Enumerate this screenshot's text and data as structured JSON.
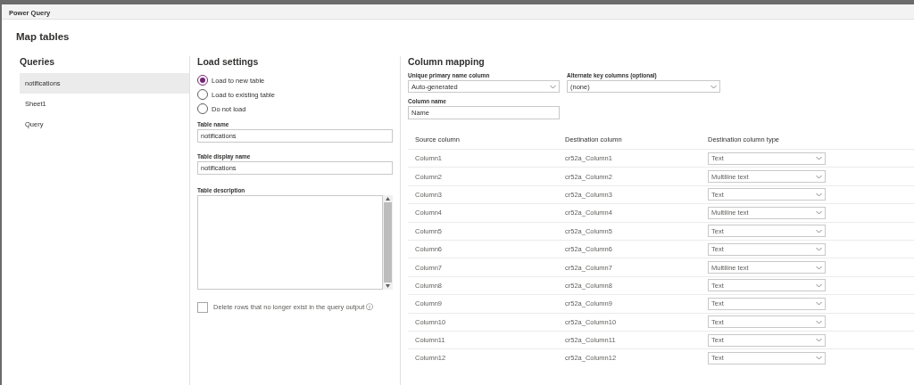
{
  "window": {
    "title": "Power Query"
  },
  "page_title": "Map tables",
  "queries": {
    "heading": "Queries",
    "items": [
      {
        "label": "notifications",
        "selected": true
      },
      {
        "label": "Sheet1",
        "selected": false
      },
      {
        "label": "Query",
        "selected": false
      }
    ]
  },
  "load_settings": {
    "heading": "Load settings",
    "options": [
      {
        "label": "Load to new table",
        "selected": true
      },
      {
        "label": "Load to existing table",
        "selected": false
      },
      {
        "label": "Do not load",
        "selected": false
      }
    ],
    "table_name": {
      "label": "Table name",
      "value": "notifications"
    },
    "table_display_name": {
      "label": "Table display name",
      "value": "notifications"
    },
    "table_description": {
      "label": "Table description"
    },
    "delete_rows": {
      "label": "Delete rows that no longer exist in the query output",
      "info": "ⓘ",
      "checked": false
    }
  },
  "column_mapping": {
    "heading": "Column mapping",
    "primary_name": {
      "label": "Unique primary name column",
      "value": "Auto-generated"
    },
    "alternate_key": {
      "label": "Alternate key columns (optional)",
      "value": "(none)"
    },
    "column_name": {
      "label": "Column name",
      "value": "Name"
    },
    "columns": [
      "Source column",
      "Destination column",
      "Destination column type"
    ],
    "rows": [
      [
        "Column1",
        "cr52a_Column1",
        "Text"
      ],
      [
        "Column2",
        "cr52a_Column2",
        "Multiline text"
      ],
      [
        "Column3",
        "cr52a_Column3",
        "Text"
      ],
      [
        "Column4",
        "cr52a_Column4",
        "Multiline text"
      ],
      [
        "Column5",
        "cr52a_Column5",
        "Text"
      ],
      [
        "Column6",
        "cr52a_Column6",
        "Text"
      ],
      [
        "Column7",
        "cr52a_Column7",
        "Multiline text"
      ],
      [
        "Column8",
        "cr52a_Column8",
        "Text"
      ],
      [
        "Column9",
        "cr52a_Column9",
        "Text"
      ],
      [
        "Column10",
        "cr52a_Column10",
        "Text"
      ],
      [
        "Column11",
        "cr52a_Column11",
        "Text"
      ],
      [
        "Column12",
        "cr52a_Column12",
        "Text"
      ]
    ]
  }
}
